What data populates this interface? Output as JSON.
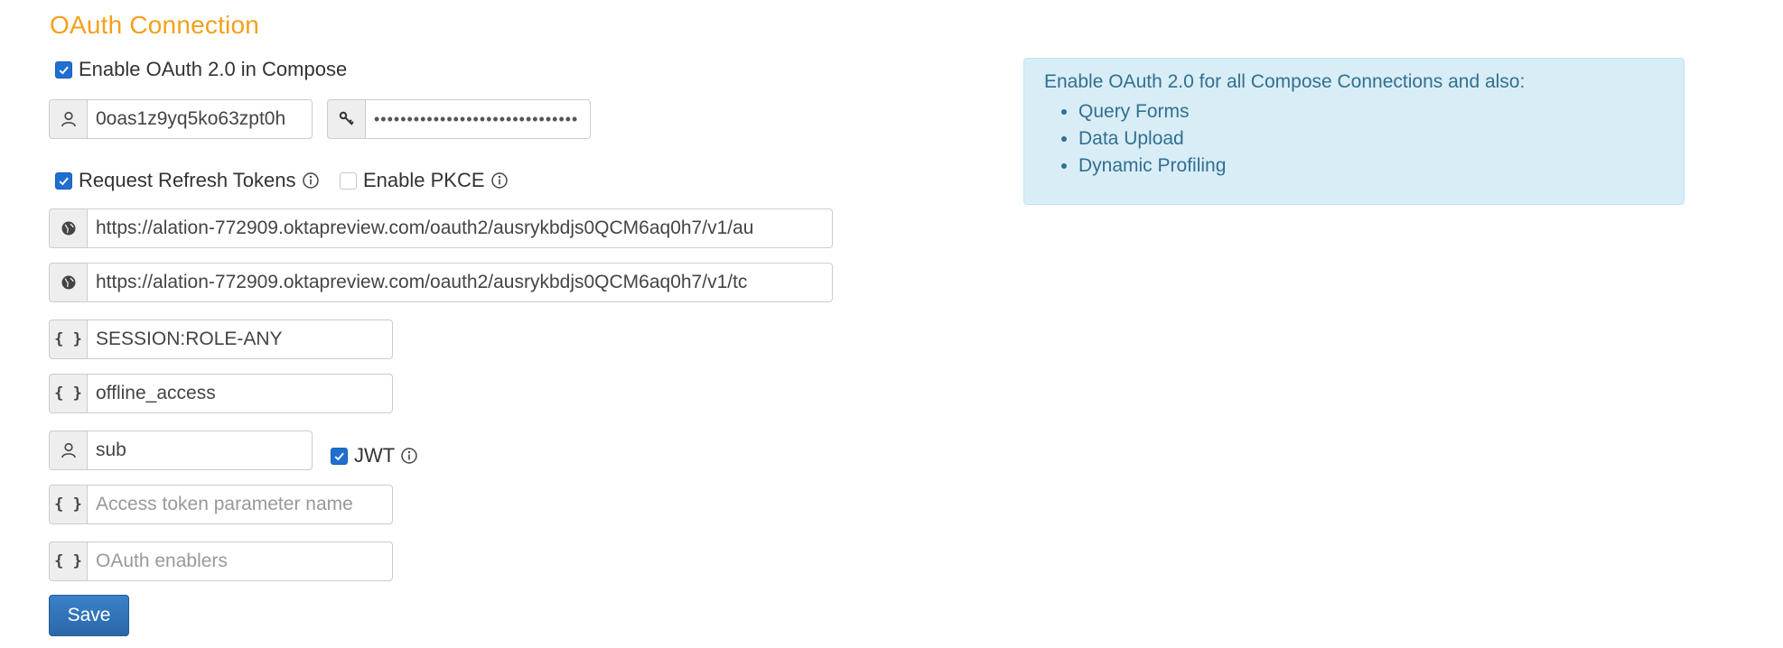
{
  "section": {
    "title": "OAuth Connection"
  },
  "enable_oauth": {
    "label": "Enable OAuth 2.0 in Compose",
    "checked": true
  },
  "client_id": {
    "value": "0oas1z9yq5ko63zpt0h",
    "icon": "user-icon"
  },
  "client_secret": {
    "value": "•••••••••••••••••••••••••••••••",
    "icon": "key-icon"
  },
  "request_refresh_tokens": {
    "label": "Request Refresh Tokens",
    "checked": true
  },
  "enable_pkce": {
    "label": "Enable PKCE",
    "checked": false
  },
  "auth_url": {
    "value": "https://alation-772909.oktapreview.com/oauth2/ausrykbdjs0QCM6aq0h7/v1/au",
    "icon": "globe-icon"
  },
  "token_url": {
    "value": "https://alation-772909.oktapreview.com/oauth2/ausrykbdjs0QCM6aq0h7/v1/tc",
    "icon": "globe-icon"
  },
  "scope_1": {
    "value": "SESSION:ROLE-ANY",
    "icon_text": "{ }"
  },
  "scope_2": {
    "value": "offline_access",
    "icon_text": "{ }"
  },
  "username_claim": {
    "value": "sub",
    "icon": "user-icon"
  },
  "jwt": {
    "label": "JWT",
    "checked": true
  },
  "access_token_param": {
    "value": "",
    "placeholder": "Access token parameter name",
    "icon_text": "{ }"
  },
  "oauth_enablers": {
    "value": "",
    "placeholder": "OAuth enablers",
    "icon_text": "{ }"
  },
  "info_box": {
    "heading": "Enable OAuth 2.0 for all Compose Connections and also:",
    "items": [
      "Query Forms",
      "Data Upload",
      "Dynamic Profiling"
    ]
  },
  "save_button": {
    "label": "Save"
  },
  "colors": {
    "title": "#f5a01a",
    "checkbox_on": "#1f6fd1",
    "info_bg": "#d9edf7",
    "info_text": "#31708f",
    "save_bg": "#2a67a8"
  }
}
